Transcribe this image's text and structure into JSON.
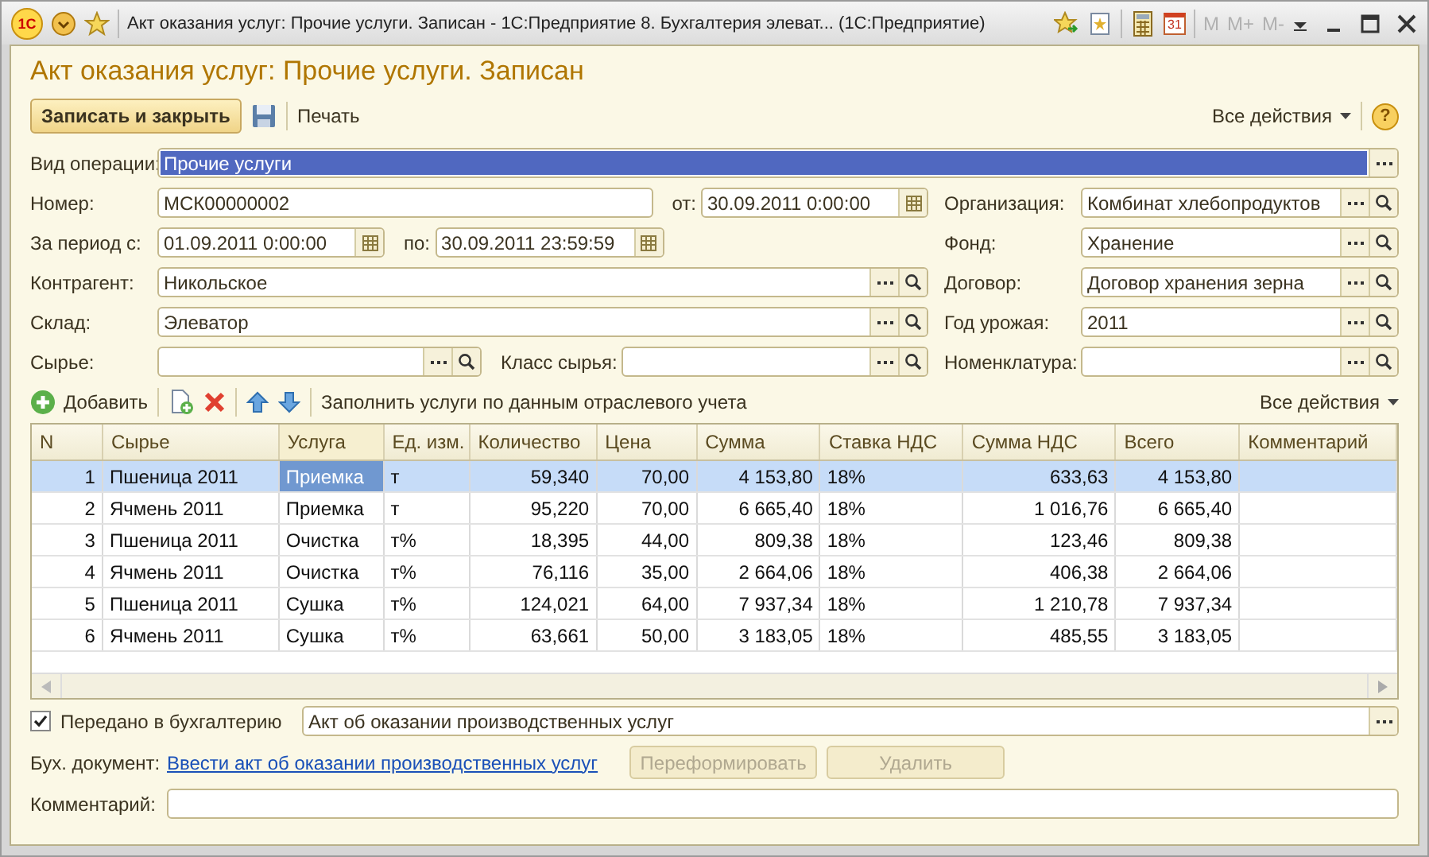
{
  "titlebar": {
    "logo": "1С",
    "title": "Акт оказания услуг: Прочие услуги. Записан - 1С:Предприятие 8. Бухгалтерия элеват...  (1С:Предприятие)",
    "calendar_day": "31",
    "memory_buttons": [
      {
        "label": "M",
        "disabled": true
      },
      {
        "label": "M+",
        "disabled": true
      },
      {
        "label": "M-",
        "disabled": true
      }
    ]
  },
  "form": {
    "title": "Акт оказания услуг: Прочие услуги. Записан",
    "save_close": "Записать и закрыть",
    "print": "Печать",
    "all_actions": "Все действия",
    "help": "?"
  },
  "operation": {
    "label": "Вид операции:",
    "value": "Прочие услуги",
    "selected": true
  },
  "left_rows": [
    [
      {
        "label": "Номер:",
        "value": "МСК00000002",
        "kind": "text"
      },
      {
        "label": "от:",
        "value": "30.09.2011  0:00:00",
        "kind": "date"
      }
    ],
    [
      {
        "label": "За период с:",
        "value": "01.09.2011  0:00:00",
        "kind": "date"
      },
      {
        "label": "по:",
        "value": "30.09.2011 23:59:59",
        "kind": "date"
      }
    ],
    [
      {
        "label": "Контрагент:",
        "value": "Никольское",
        "kind": "ref"
      }
    ],
    [
      {
        "label": "Склад:",
        "value": "Элеватор",
        "kind": "ref"
      }
    ],
    [
      {
        "label": "Сырье:",
        "kind": "ref"
      },
      {
        "label": "Класс сырья:",
        "kind": "ref"
      }
    ]
  ],
  "right_fields": [
    {
      "label": "Организация:",
      "value": "Комбинат хлебопродуктов",
      "kind": "ref"
    },
    {
      "label": "Фонд:",
      "value": "Хранение",
      "kind": "ref"
    },
    {
      "label": "Договор:",
      "value": "Договор хранения зерна",
      "kind": "ref"
    },
    {
      "label": "Год урожая:",
      "value": "2011",
      "kind": "ref"
    },
    {
      "label": "Номенклатура:",
      "kind": "ref"
    }
  ],
  "table_toolbar": {
    "add": "Добавить",
    "fill": "Заполнить услуги по данным отраслевого учета",
    "all_actions": "Все действия"
  },
  "table": {
    "columns": [
      {
        "label": "N",
        "kind": "number",
        "current": false
      },
      {
        "label": "Сырье",
        "kind": "text",
        "current": false
      },
      {
        "label": "Услуга",
        "kind": "text",
        "current": true
      },
      {
        "label": "Ед. изм.",
        "kind": "text",
        "current": false
      },
      {
        "label": "Количество",
        "kind": "number",
        "current": false
      },
      {
        "label": "Цена",
        "kind": "number",
        "current": false
      },
      {
        "label": "Сумма",
        "kind": "number",
        "current": false
      },
      {
        "label": "Ставка НДС",
        "kind": "text",
        "current": false
      },
      {
        "label": "Сумма НДС",
        "kind": "number",
        "current": false
      },
      {
        "label": "Всего",
        "kind": "number",
        "current": false
      },
      {
        "label": "Комментарий",
        "kind": "text",
        "current": false
      }
    ],
    "rows": [
      {
        "selected": true,
        "cells": [
          "1",
          "Пшеница 2011",
          "Приемка",
          "т",
          "59,340",
          "70,00",
          "4 153,80",
          "18%",
          "633,63",
          "4 153,80",
          ""
        ]
      },
      {
        "selected": false,
        "cells": [
          "2",
          "Ячмень 2011",
          "Приемка",
          "т",
          "95,220",
          "70,00",
          "6 665,40",
          "18%",
          "1 016,76",
          "6 665,40",
          ""
        ]
      },
      {
        "selected": false,
        "cells": [
          "3",
          "Пшеница 2011",
          "Очистка",
          "т%",
          "18,395",
          "44,00",
          "809,38",
          "18%",
          "123,46",
          "809,38",
          ""
        ]
      },
      {
        "selected": false,
        "cells": [
          "4",
          "Ячмень 2011",
          "Очистка",
          "т%",
          "76,116",
          "35,00",
          "2 664,06",
          "18%",
          "406,38",
          "2 664,06",
          ""
        ]
      },
      {
        "selected": false,
        "cells": [
          "5",
          "Пшеница 2011",
          "Сушка",
          "т%",
          "124,021",
          "64,00",
          "7 937,34",
          "18%",
          "1 210,78",
          "7 937,34",
          ""
        ]
      },
      {
        "selected": false,
        "cells": [
          "6",
          "Ячмень 2011",
          "Сушка",
          "т%",
          "63,661",
          "50,00",
          "3 183,05",
          "18%",
          "485,55",
          "3 183,05",
          ""
        ]
      }
    ]
  },
  "transferred": {
    "label": "Передано в бухгалтерию",
    "checked": true,
    "value": "Акт об оказании производственных услуг"
  },
  "accounting_doc": {
    "label": "Бух. документ:",
    "link": "Ввести акт об оказании производственных услуг",
    "buttons": [
      {
        "label": "Переформировать",
        "disabled": true
      },
      {
        "label": "Удалить",
        "disabled": true
      }
    ]
  },
  "comment": {
    "label": "Комментарий:"
  }
}
